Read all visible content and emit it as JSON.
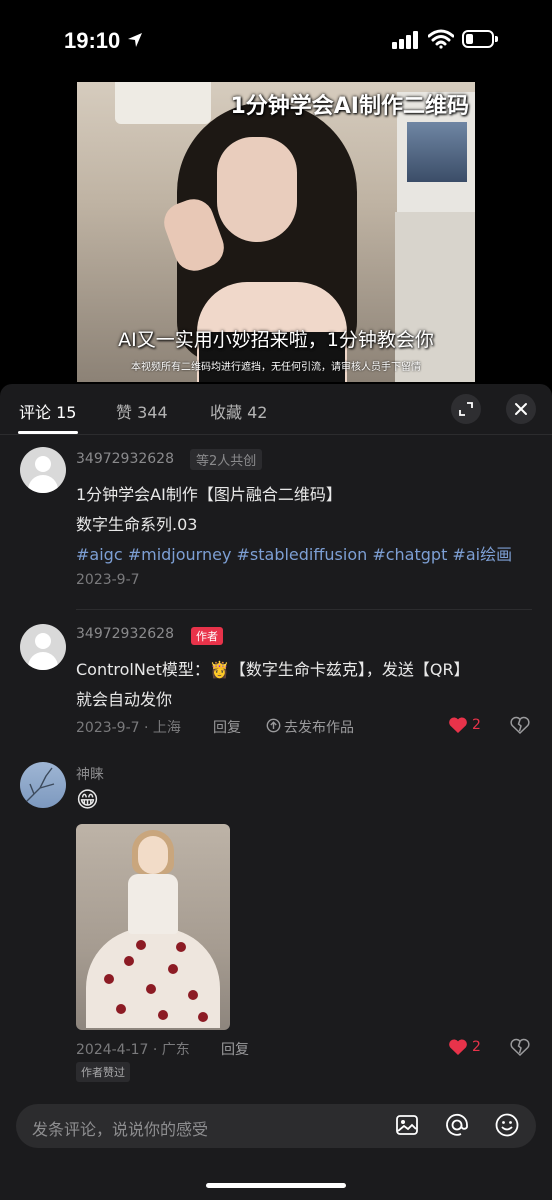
{
  "status_bar": {
    "time": "19:10"
  },
  "video": {
    "title": "1分钟学会AI制作二维码",
    "subtitle": "AI又一实用小妙招来啦，1分钟教会你",
    "note": "本视频所有二维码均进行遮挡，无任何引流，请审核人员手下留情"
  },
  "tabs": [
    {
      "label": "评论 15"
    },
    {
      "label": "赞 344"
    },
    {
      "label": "收藏 42"
    }
  ],
  "post": {
    "username": "34972932628",
    "cocreate_badge": "等2人共创",
    "line1": "1分钟学会AI制作【图片融合二维码】",
    "line2": "数字生命系列.03",
    "tags": "#aigc #midjourney #stablediffusion #chatgpt #ai绘画",
    "date": "2023-9-7"
  },
  "comments": [
    {
      "username": "34972932628",
      "badge": "作者",
      "line1": "ControlNet模型：👸【数字生命卡兹克】，发送【QR】",
      "line2": "就会自动发你",
      "meta": "2023-9-7 · 上海",
      "reply": "回复",
      "publish": "去发布作品",
      "likes": "2"
    },
    {
      "username": "神睐",
      "emoji": "😁",
      "meta": "2024-4-17 · 广东",
      "reply": "回复",
      "likes": "2",
      "liked_by_author": "作者赞过"
    }
  ],
  "composer": {
    "placeholder": "发条评论，说说你的感受"
  },
  "colors": {
    "accent_red": "#e8334a",
    "tag_blue": "#7d9fd4",
    "sheet_bg": "#1b1b1d"
  }
}
